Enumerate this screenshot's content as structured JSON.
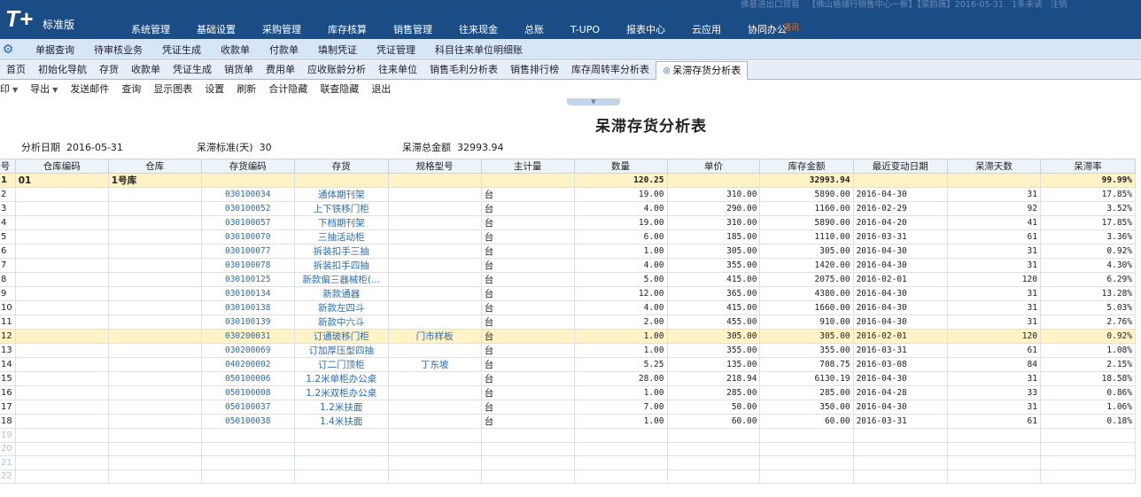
{
  "app": {
    "logo_mark": "T+",
    "edition": "标准版",
    "status": [
      "佛基进出口贸易",
      "【佛山格储行销售中心一新】【梁韵薇】2016-05-31",
      "1条未读",
      "注销"
    ]
  },
  "main_menu": [
    {
      "label": "系统管理"
    },
    {
      "label": "基础设置"
    },
    {
      "label": "采购管理"
    },
    {
      "label": "库存核算"
    },
    {
      "label": "销售管理"
    },
    {
      "label": "往来现金"
    },
    {
      "label": "总账"
    },
    {
      "label": "T-UPO"
    },
    {
      "label": "报表中心"
    },
    {
      "label": "云应用"
    },
    {
      "label": "协同办公",
      "badge": "通讯"
    }
  ],
  "sub_menu": [
    "单据查询",
    "待审核业务",
    "凭证生成",
    "收款单",
    "付款单",
    "填制凭证",
    "凭证管理",
    "科目往来单位明细账"
  ],
  "tabs": [
    "首页",
    "初始化导航",
    "存货",
    "收款单",
    "凭证生成",
    "销货单",
    "费用单",
    "应收账龄分析",
    "往来单位",
    "销售毛利分析表",
    "销售排行榜",
    "库存周转率分析表",
    "呆滞存货分析表"
  ],
  "active_tab": 12,
  "toolbar": [
    "印",
    "导出",
    "发送邮件",
    "查询",
    "显示图表",
    "设置",
    "刷新",
    "合计隐藏",
    "联查隐藏",
    "退出"
  ],
  "report": {
    "title": "呆滞存货分析表",
    "params": {
      "date_label": "分析日期",
      "date_value": "2016-05-31",
      "std_label": "呆滞标准(天)",
      "std_value": "30",
      "total_label": "呆滞总金额",
      "total_value": "32993.94"
    }
  },
  "grid": {
    "columns": [
      "号",
      "仓库编码",
      "仓库",
      "存货编码",
      "存货",
      "规格型号",
      "主计量",
      "数量",
      "单价",
      "库存金额",
      "最近变动日期",
      "呆滞天数",
      "呆滞率"
    ],
    "rows": [
      [
        "1",
        "01",
        "1号库",
        "",
        "",
        "",
        "",
        "120.25",
        "",
        "32993.94",
        "",
        "",
        "99.99%"
      ],
      [
        "2",
        "",
        "",
        "030100034",
        "通体期刊架",
        "",
        "台",
        "19.00",
        "310.00",
        "5890.00",
        "2016-04-30",
        "31",
        "17.85%"
      ],
      [
        "3",
        "",
        "",
        "030100052",
        "上下铁移门柜",
        "",
        "台",
        "4.00",
        "290.00",
        "1160.00",
        "2016-02-29",
        "92",
        "3.52%"
      ],
      [
        "4",
        "",
        "",
        "030100057",
        "下档期刊架",
        "",
        "台",
        "19.00",
        "310.00",
        "5890.00",
        "2016-04-20",
        "41",
        "17.85%"
      ],
      [
        "5",
        "",
        "",
        "030100070",
        "三抽活动柜",
        "",
        "台",
        "6.00",
        "185.00",
        "1110.00",
        "2016-03-31",
        "61",
        "3.36%"
      ],
      [
        "6",
        "",
        "",
        "030100077",
        "拆装扣手三抽",
        "",
        "台",
        "1.00",
        "305.00",
        "305.00",
        "2016-04-30",
        "31",
        "0.92%"
      ],
      [
        "7",
        "",
        "",
        "030100078",
        "拆装扣手四抽",
        "",
        "台",
        "4.00",
        "355.00",
        "1420.00",
        "2016-04-30",
        "31",
        "4.30%"
      ],
      [
        "8",
        "",
        "",
        "030100125",
        "新款偏三器械柜(...",
        "",
        "台",
        "5.00",
        "415.00",
        "2075.00",
        "2016-02-01",
        "120",
        "6.29%"
      ],
      [
        "9",
        "",
        "",
        "030100134",
        "新款通器",
        "",
        "台",
        "12.00",
        "365.00",
        "4380.00",
        "2016-04-30",
        "31",
        "13.28%"
      ],
      [
        "10",
        "",
        "",
        "030100138",
        "新款左四斗",
        "",
        "台",
        "4.00",
        "415.00",
        "1660.00",
        "2016-04-30",
        "31",
        "5.03%"
      ],
      [
        "11",
        "",
        "",
        "030100139",
        "新款中六斗",
        "",
        "台",
        "2.00",
        "455.00",
        "910.00",
        "2016-04-30",
        "31",
        "2.76%"
      ],
      [
        "12",
        "",
        "",
        "030200031",
        "订通玻移门柜",
        "门市样板",
        "台",
        "1.00",
        "305.00",
        "305.00",
        "2016-02-01",
        "120",
        "0.92%"
      ],
      [
        "13",
        "",
        "",
        "030200069",
        "订加厚压型四抽",
        "",
        "台",
        "1.00",
        "355.00",
        "355.00",
        "2016-03-31",
        "61",
        "1.08%"
      ],
      [
        "14",
        "",
        "",
        "040200002",
        "订二门顶柜",
        "丁东坡",
        "台",
        "5.25",
        "135.00",
        "708.75",
        "2016-03-08",
        "84",
        "2.15%"
      ],
      [
        "15",
        "",
        "",
        "050100006",
        "1.2米单柜办公桌",
        "",
        "台",
        "28.00",
        "218.94",
        "6130.19",
        "2016-04-30",
        "31",
        "18.58%"
      ],
      [
        "16",
        "",
        "",
        "050100008",
        "1.2米双柜办公桌",
        "",
        "台",
        "1.00",
        "285.00",
        "285.00",
        "2016-04-28",
        "33",
        "0.86%"
      ],
      [
        "17",
        "",
        "",
        "050100037",
        "1.2米扶面",
        "",
        "台",
        "7.00",
        "50.00",
        "350.00",
        "2016-04-30",
        "31",
        "1.06%"
      ],
      [
        "18",
        "",
        "",
        "050100038",
        "1.4米扶面",
        "",
        "台",
        "1.00",
        "60.00",
        "60.00",
        "2016-03-31",
        "61",
        "0.18%"
      ]
    ],
    "empty_rows": [
      "19",
      "20",
      "21",
      "22"
    ],
    "highlight_rows": [
      0,
      11
    ]
  }
}
